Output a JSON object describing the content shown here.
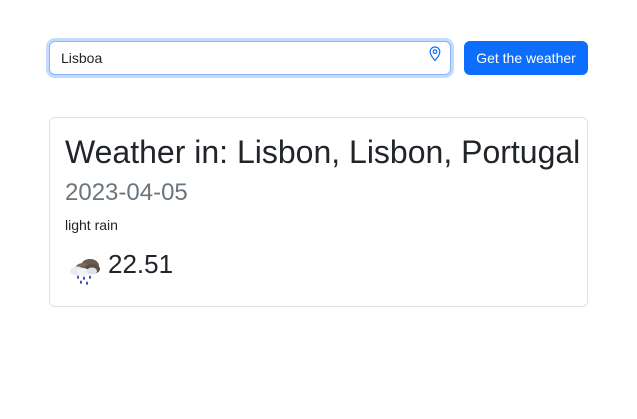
{
  "search": {
    "value": "Lisboa",
    "button_label": "Get the weather"
  },
  "weather": {
    "title": "Weather in: Lisbon, Lisbon, Portugal",
    "date": "2023-04-05",
    "description": "light rain",
    "temperature": "22.51",
    "icon": "light-rain-cloud-icon"
  },
  "colors": {
    "primary": "#0d6efd",
    "muted": "#6c757d",
    "border": "#dee2e6"
  }
}
